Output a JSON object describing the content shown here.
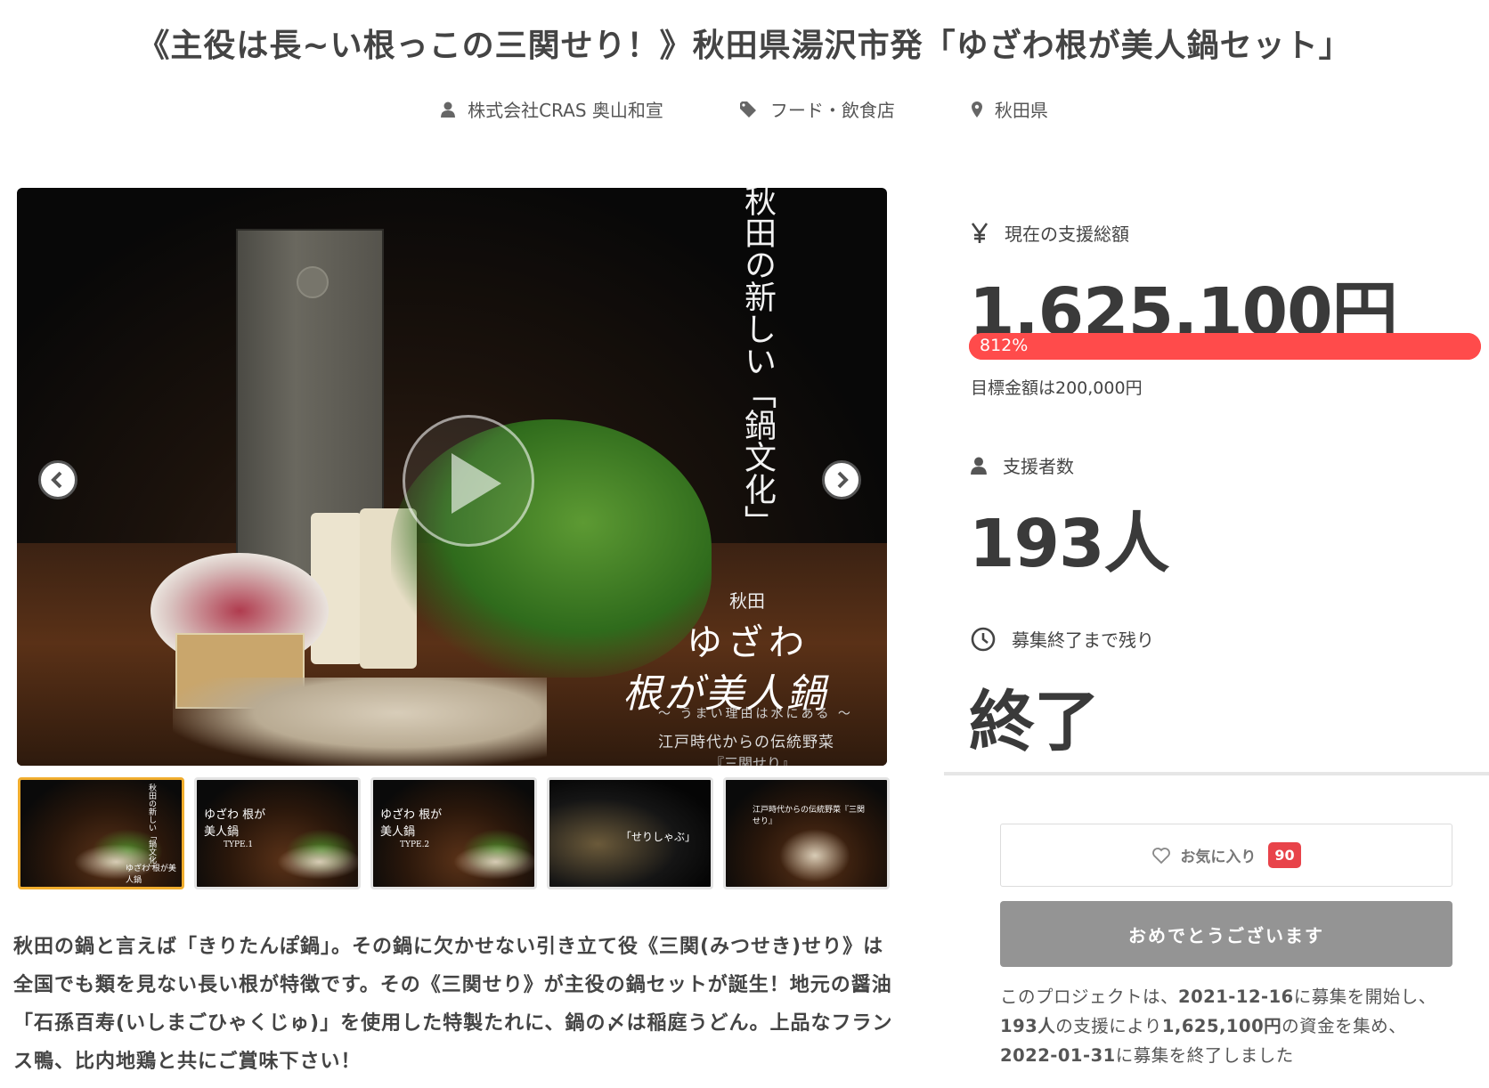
{
  "project": {
    "title": "《主役は長~い根っこの三関せり！》秋田県湯沢市発「ゆざわ根が美人鍋セット」",
    "owner": "株式会社CRAS 奥山和宣",
    "category": "フード・飲食店",
    "location": "秋田県"
  },
  "hero": {
    "vertical_text": "秋田の新しい「鍋文化」",
    "logo_small": "秋田",
    "logo_kana": "ゆざわ",
    "logo_main": "根が美人鍋",
    "logo_sub": "～ うまい理由は水にある ～",
    "caption_1": "江戸時代からの伝統野菜",
    "caption_2": "『三関せり』"
  },
  "thumbnails": [
    {
      "caption": "秋田の新しい「鍋文化」",
      "sub": "ゆざわ 根が美人鍋"
    },
    {
      "caption": "ゆざわ 根が美人鍋",
      "sub": "TYPE.1"
    },
    {
      "caption": "ゆざわ 根が美人鍋",
      "sub": "TYPE.2"
    },
    {
      "caption": "「せりしゃぶ」",
      "sub": ""
    },
    {
      "caption": "江戸時代からの伝統野菜『三関せり』",
      "sub": ""
    }
  ],
  "description": "秋田の鍋と言えば「きりたんぽ鍋」。その鍋に欠かせない引き立て役《三関(みつせき)せり》は全国でも類を見ない長い根が特徴です。その《三関せり》が主役の鍋セットが誕生！地元の醤油「石孫百寿(いしまごひゃくじゅ)」を使用した特製たれに、鍋の〆は稲庭うどん。上品なフランス鴨、比内地鶏と共にご賞味下さい！",
  "stats": {
    "amount_label": "現在の支援総額",
    "amount": "1,625,100円",
    "percent": "812%",
    "percent_value": 812,
    "goal": "目標金額は200,000円",
    "supporters_label": "支援者数",
    "supporters": "193人",
    "remaining_label": "募集終了まで残り",
    "remaining": "終了"
  },
  "actions": {
    "favorite_label": "お気に入り",
    "favorite_count": "90",
    "congrats_label": "おめでとうございます"
  },
  "summary": {
    "p1": "このプロジェクトは、",
    "start": "2021-12-16",
    "p2": "に募集を開始し、",
    "supporters": "193人",
    "p3": "の支援により",
    "amount": "1,625,100円",
    "p4": "の資金を集め、",
    "end": "2022-01-31",
    "p5": "に募集を終了しました"
  },
  "colors": {
    "progress": "#ff4b4b",
    "favorite_badge": "#e8434a",
    "congrats_button": "#949494",
    "thumb_active": "#f0ad2e"
  },
  "icons": [
    "user-icon",
    "tag-icon",
    "location-pin-icon",
    "yen-icon",
    "clock-icon",
    "heart-icon",
    "chevron-left-icon",
    "chevron-right-icon",
    "play-icon"
  ]
}
